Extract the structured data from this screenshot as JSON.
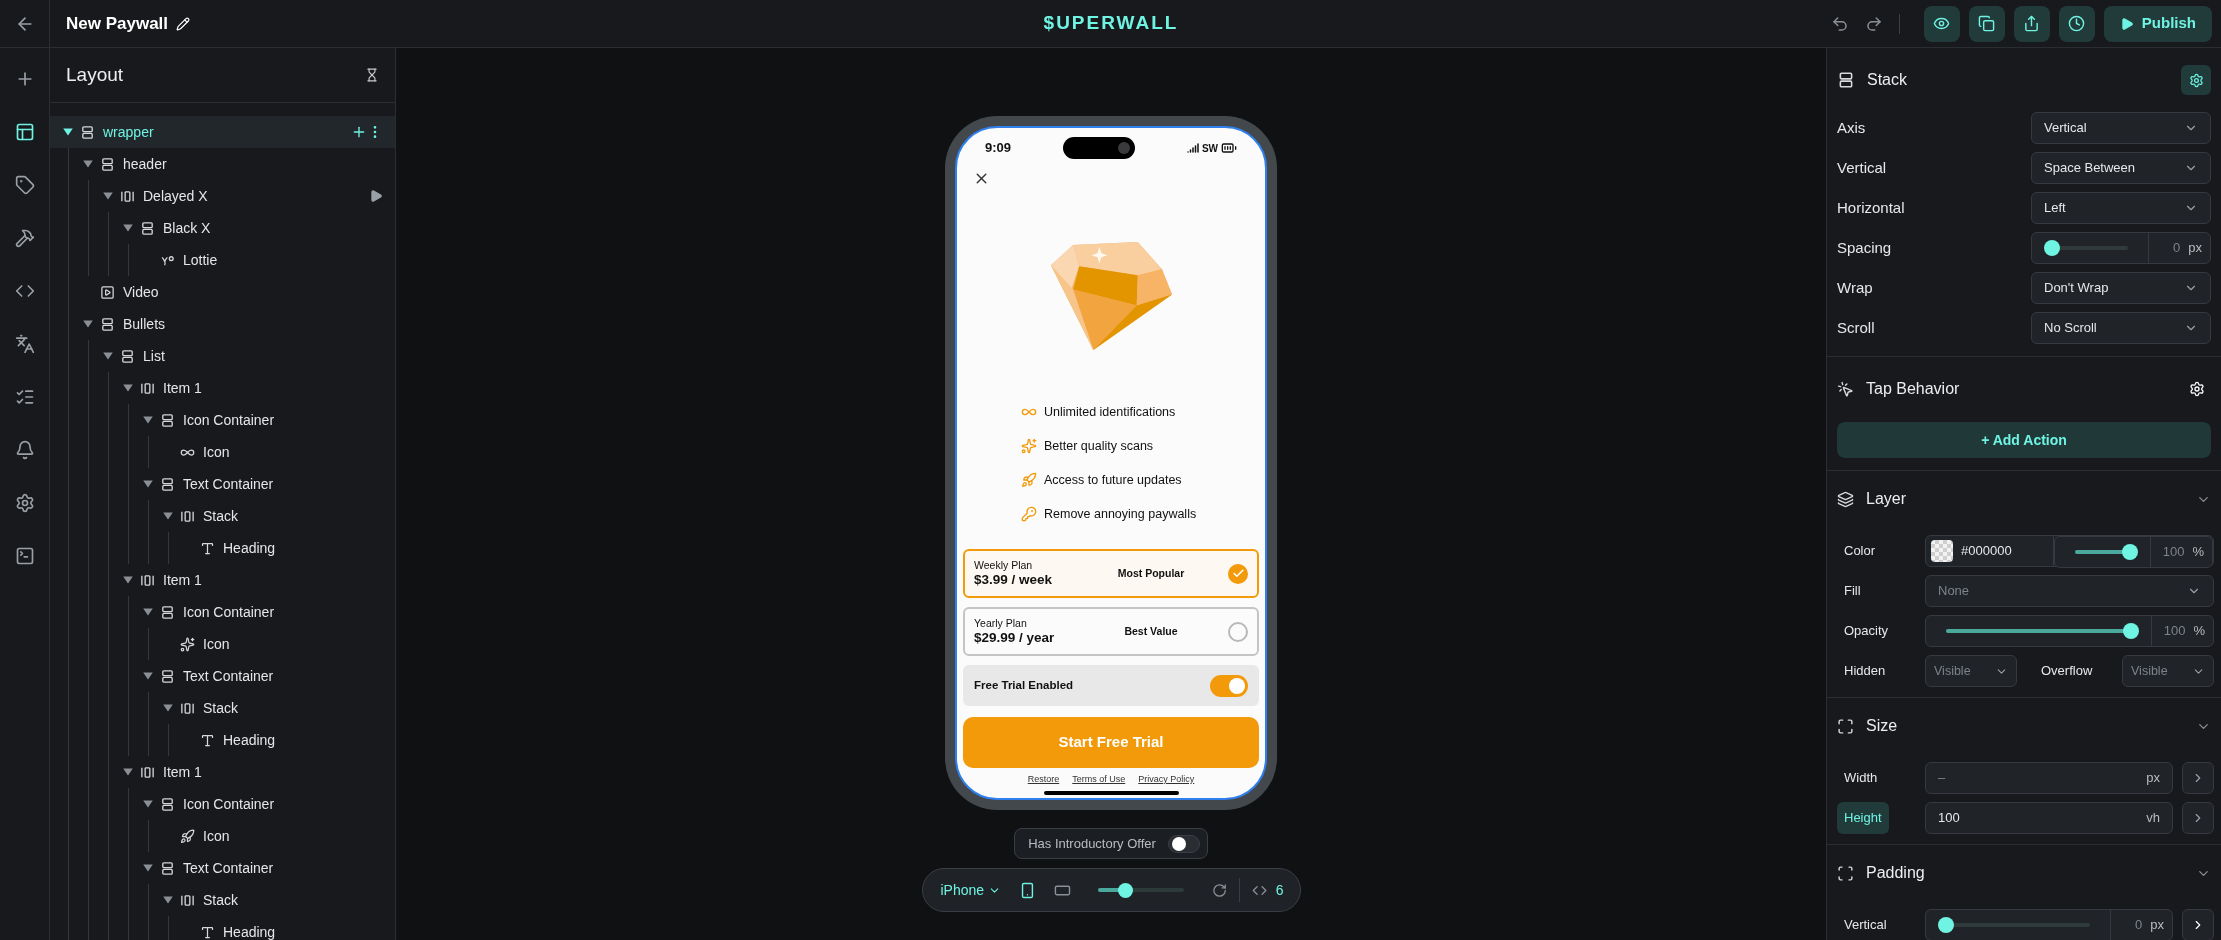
{
  "top_bar": {
    "title": "New Paywall",
    "logo": "$UPERWALL",
    "publish": "Publish"
  },
  "rail": [
    {
      "selected": false
    },
    {
      "selected": true
    },
    {
      "selected": false
    },
    {
      "selected": false
    },
    {
      "selected": false
    },
    {
      "selected": false
    },
    {
      "selected": false
    },
    {
      "selected": false
    },
    {
      "selected": false
    },
    {
      "selected": false
    }
  ],
  "layers": {
    "title": "Layout",
    "tree": [
      {
        "label": "wrapper",
        "kind": "stack-v",
        "selected": true,
        "playable": false,
        "expanded": true,
        "children": [
          {
            "label": "header",
            "kind": "stack-v",
            "selected": false,
            "playable": false,
            "expanded": true,
            "children": [
              {
                "label": "Delayed X",
                "kind": "stack-h",
                "selected": false,
                "playable": true,
                "expanded": true,
                "children": [
                  {
                    "label": "Black X",
                    "kind": "stack-v",
                    "selected": false,
                    "playable": false,
                    "expanded": true,
                    "children": [
                      {
                        "label": "Lottie",
                        "kind": "lottie",
                        "selected": false,
                        "playable": false
                      }
                    ]
                  }
                ]
              }
            ]
          },
          {
            "label": "Video",
            "kind": "video",
            "selected": false,
            "playable": false
          },
          {
            "label": "Bullets",
            "kind": "stack-v",
            "selected": false,
            "playable": false,
            "expanded": true,
            "children": [
              {
                "label": "List",
                "kind": "stack-v",
                "selected": false,
                "playable": false,
                "expanded": true,
                "children": [
                  {
                    "label": "Item 1",
                    "kind": "stack-h",
                    "selected": false,
                    "playable": false,
                    "expanded": true,
                    "children": [
                      {
                        "label": "Icon Container",
                        "kind": "stack-v",
                        "selected": false,
                        "playable": false,
                        "expanded": true,
                        "children": [
                          {
                            "label": "Icon",
                            "kind": "infinity",
                            "selected": false,
                            "playable": false
                          }
                        ]
                      },
                      {
                        "label": "Text Container",
                        "kind": "stack-v",
                        "selected": false,
                        "playable": false,
                        "expanded": true,
                        "children": [
                          {
                            "label": "Stack",
                            "kind": "stack-h",
                            "selected": false,
                            "playable": false,
                            "expanded": true,
                            "children": [
                              {
                                "label": "Heading",
                                "kind": "text",
                                "selected": false,
                                "playable": false
                              }
                            ]
                          }
                        ]
                      }
                    ]
                  },
                  {
                    "label": "Item 1",
                    "kind": "stack-h",
                    "selected": false,
                    "playable": false,
                    "expanded": true,
                    "children": [
                      {
                        "label": "Icon Container",
                        "kind": "stack-v",
                        "selected": false,
                        "playable": false,
                        "expanded": true,
                        "children": [
                          {
                            "label": "Icon",
                            "kind": "sparkle",
                            "selected": false,
                            "playable": false
                          }
                        ]
                      },
                      {
                        "label": "Text Container",
                        "kind": "stack-v",
                        "selected": false,
                        "playable": false,
                        "expanded": true,
                        "children": [
                          {
                            "label": "Stack",
                            "kind": "stack-h",
                            "selected": false,
                            "playable": false,
                            "expanded": true,
                            "children": [
                              {
                                "label": "Heading",
                                "kind": "text",
                                "selected": false,
                                "playable": false
                              }
                            ]
                          }
                        ]
                      }
                    ]
                  },
                  {
                    "label": "Item 1",
                    "kind": "stack-h",
                    "selected": false,
                    "playable": false,
                    "expanded": true,
                    "children": [
                      {
                        "label": "Icon Container",
                        "kind": "stack-v",
                        "selected": false,
                        "playable": false,
                        "expanded": true,
                        "children": [
                          {
                            "label": "Icon",
                            "kind": "rocket",
                            "selected": false,
                            "playable": false
                          }
                        ]
                      },
                      {
                        "label": "Text Container",
                        "kind": "stack-v",
                        "selected": false,
                        "playable": false,
                        "expanded": true,
                        "children": [
                          {
                            "label": "Stack",
                            "kind": "stack-h",
                            "selected": false,
                            "playable": false,
                            "expanded": true,
                            "children": [
                              {
                                "label": "Heading",
                                "kind": "text",
                                "selected": false,
                                "playable": false
                              }
                            ]
                          }
                        ]
                      }
                    ]
                  }
                ]
              }
            ]
          }
        ]
      }
    ]
  },
  "preview": {
    "status_bar": {
      "time": "9:09",
      "carrier": "SW"
    },
    "features": [
      {
        "text": "Unlimited identifications"
      },
      {
        "text": "Better quality scans"
      },
      {
        "text": "Access to future updates"
      },
      {
        "text": "Remove annoying paywalls"
      }
    ],
    "plans": [
      {
        "name": "Weekly Plan",
        "price": "$3.99 / week",
        "badge": "Most Popular",
        "selected": true
      },
      {
        "name": "Yearly Plan",
        "price": "$29.99 / year",
        "badge": "Best Value",
        "selected": false
      }
    ],
    "free_trial": {
      "label": "Free Trial Enabled",
      "on": true
    },
    "cta": "Start Free Trial",
    "links": [
      "Restore",
      "Terms of Use",
      "Privacy Policy"
    ]
  },
  "intro_offer": {
    "label": "Has Introductory Offer",
    "on": false
  },
  "device_toolbar": {
    "device": "iPhone",
    "orientations": [
      {
        "selected": true
      },
      {
        "selected": false
      }
    ],
    "zoom": {
      "level": 0.32
    },
    "code_count": "6"
  },
  "inspector": {
    "stack": {
      "title": "Stack",
      "rows": [
        {
          "label": "Axis",
          "kind": "select",
          "value": "Vertical"
        },
        {
          "label": "Vertical",
          "kind": "select",
          "value": "Space Between"
        },
        {
          "label": "Horizontal",
          "kind": "select",
          "value": "Left"
        },
        {
          "label": "Spacing",
          "kind": "slider",
          "level": 0,
          "value": "0",
          "unit": "px"
        },
        {
          "label": "Wrap",
          "kind": "select",
          "value": "Don't Wrap"
        },
        {
          "label": "Scroll",
          "kind": "select",
          "value": "No Scroll"
        }
      ]
    },
    "tap_behavior": {
      "title": "Tap Behavior",
      "button": "+ Add Action"
    },
    "layer": {
      "title": "Layer",
      "expanded": true,
      "color": {
        "label": "Color",
        "value": "#000000",
        "level": 1,
        "reading": "100",
        "unit": "%"
      },
      "fill": {
        "label": "Fill",
        "placeholder": "None"
      },
      "opacity": {
        "label": "Opacity",
        "level": 1,
        "reading": "100",
        "unit": "%"
      },
      "hidden": {
        "label": "Hidden",
        "value": "Visible"
      },
      "overflow": {
        "label": "Overflow",
        "value": "Visible"
      }
    },
    "size": {
      "title": "Size",
      "expanded": true,
      "rows": [
        {
          "label": "Width",
          "placeholder": "–",
          "unit": "px",
          "selected": false
        },
        {
          "label": "Height",
          "value": "100",
          "unit": "vh",
          "selected": true
        }
      ]
    },
    "padding": {
      "title": "Padding",
      "expanded": true,
      "rows": [
        {
          "label": "Vertical",
          "level": 0,
          "value": "0",
          "unit": "px"
        }
      ]
    }
  }
}
